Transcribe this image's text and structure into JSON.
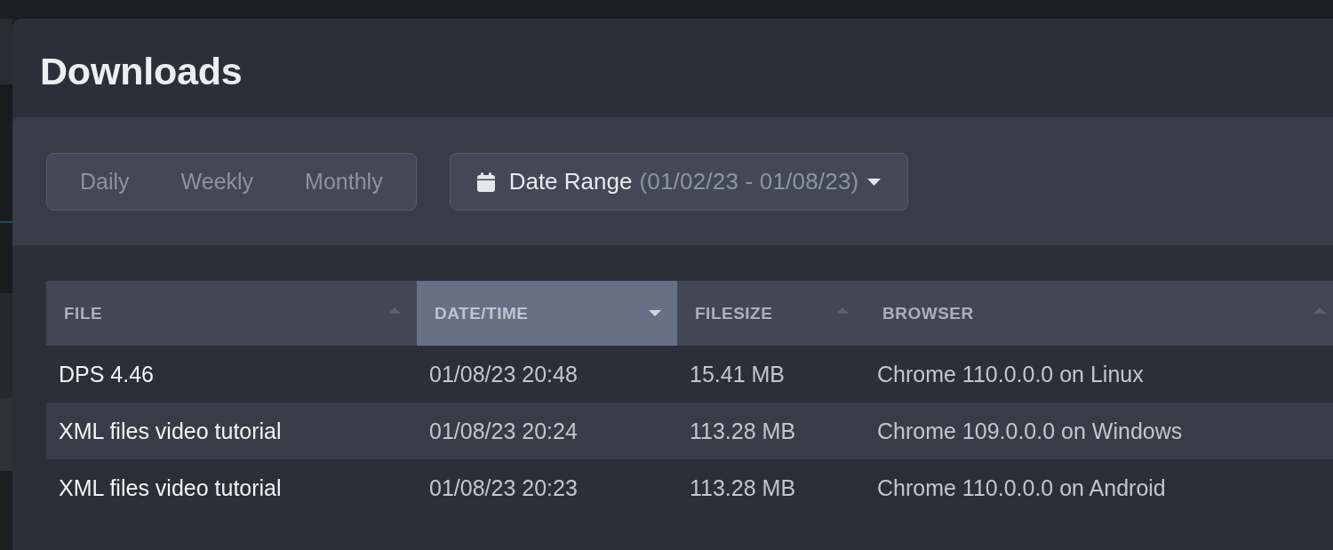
{
  "dialog": {
    "title": "Downloads"
  },
  "filters": {
    "periods": [
      {
        "label": "Daily",
        "selected": false
      },
      {
        "label": "Weekly",
        "selected": false
      },
      {
        "label": "Monthly",
        "selected": false
      }
    ],
    "date_range": {
      "label": "Date Range",
      "value": "(01/02/23 - 01/08/23)"
    }
  },
  "table": {
    "columns": [
      {
        "label": "FILE",
        "sorted": false,
        "descending": false
      },
      {
        "label": "DATE/TIME",
        "sorted": true,
        "descending": true
      },
      {
        "label": "FILESIZE",
        "sorted": false,
        "descending": false
      },
      {
        "label": "BROWSER",
        "sorted": false,
        "descending": false
      }
    ],
    "rows": [
      {
        "file": "DPS 4.46",
        "date_time": "01/08/23 20:48",
        "filesize": "15.41 MB",
        "browser": "Chrome 110.0.0.0 on Linux"
      },
      {
        "file": "XML files video tutorial",
        "date_time": "01/08/23 20:24",
        "filesize": "113.28 MB",
        "browser": "Chrome 109.0.0.0 on Windows"
      },
      {
        "file": "XML files video tutorial",
        "date_time": "01/08/23 20:23",
        "filesize": "113.28 MB",
        "browser": "Chrome 110.0.0.0 on Android"
      }
    ]
  }
}
